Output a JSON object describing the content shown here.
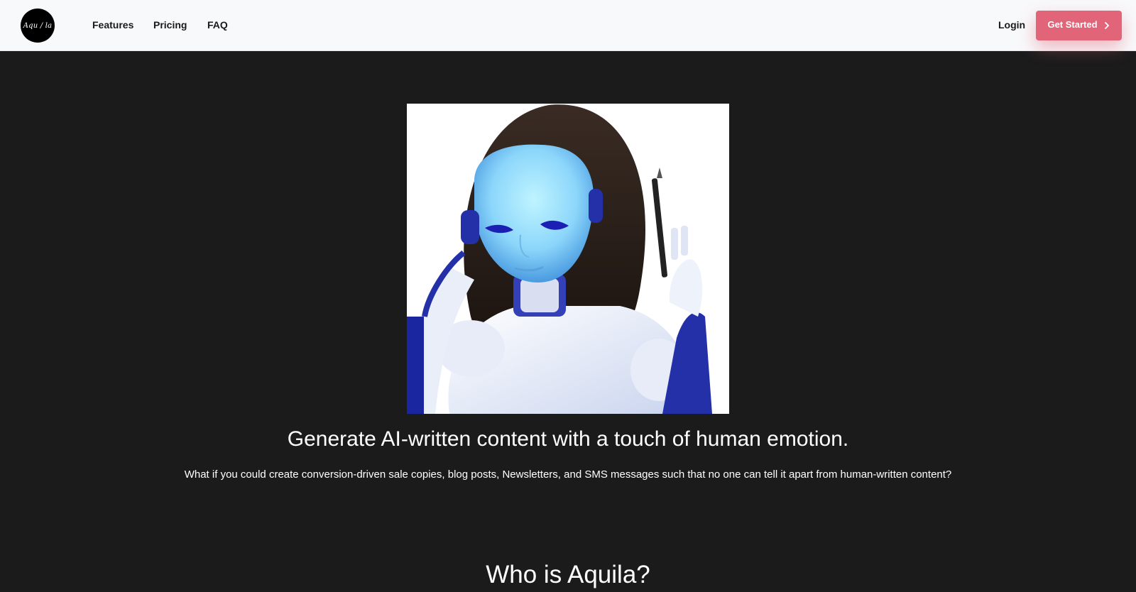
{
  "header": {
    "logo_text": "Aqu / la",
    "nav": {
      "features": "Features",
      "pricing": "Pricing",
      "faq": "FAQ"
    },
    "login_label": "Login",
    "cta_label": "Get Started"
  },
  "hero": {
    "image_icon": "robot-illustration",
    "title": "Generate AI-written content with a touch of human emotion.",
    "subtitle": "What if you could create conversion-driven sale copies, blog posts, Newsletters, and SMS messages such that no one can tell it apart from human-written content?"
  },
  "section": {
    "title": "Who is Aquila?"
  },
  "colors": {
    "page_background": "#1b1b1c",
    "header_background": "#f8f9fb",
    "accent": "#e26478"
  }
}
